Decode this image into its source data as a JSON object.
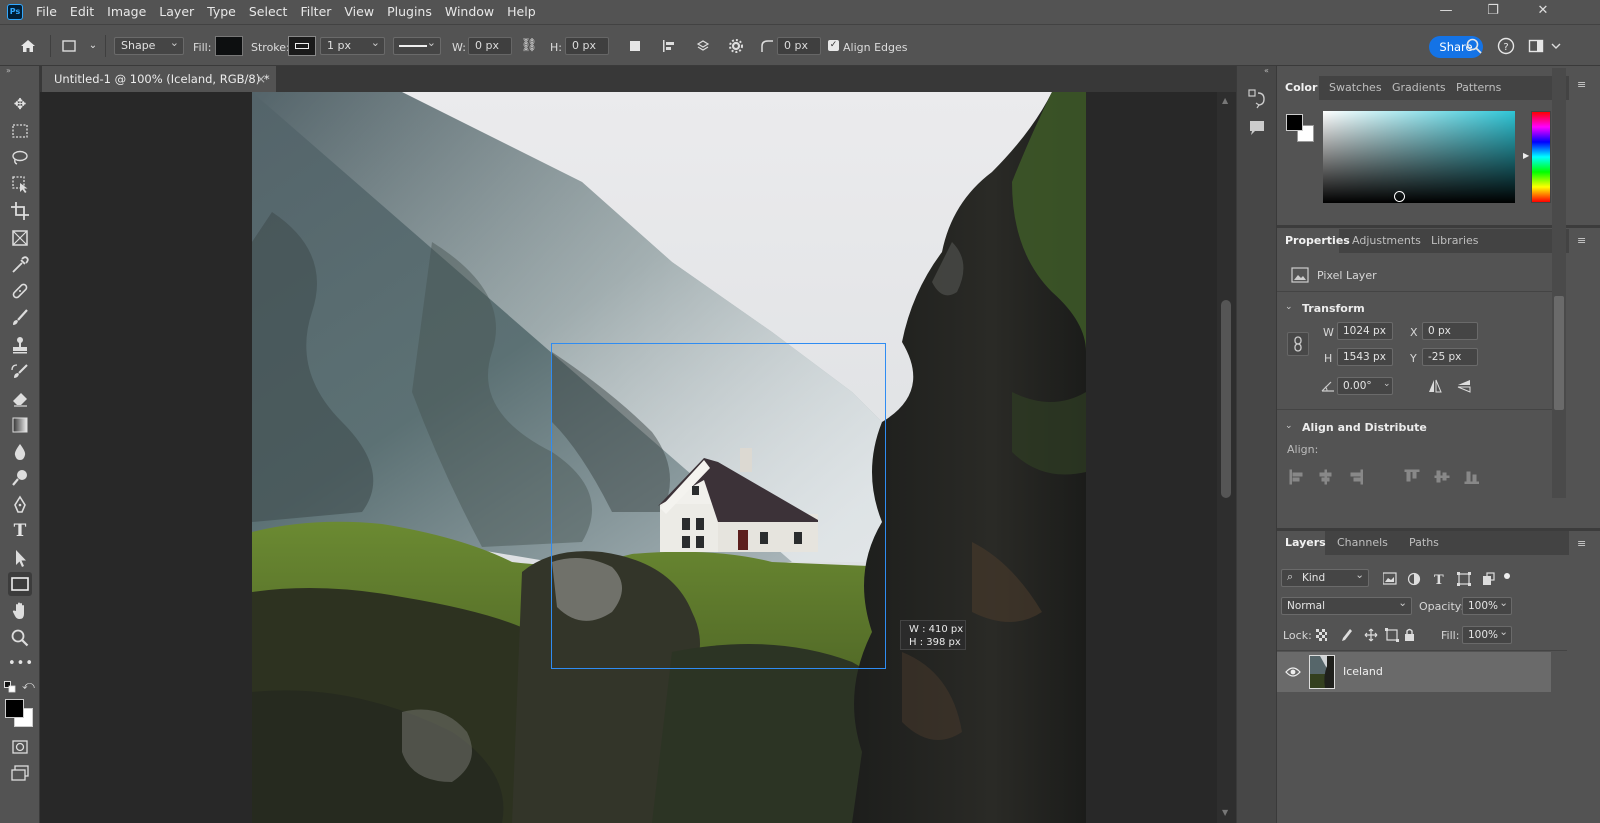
{
  "menubar": {
    "logo": "Ps",
    "items": [
      "File",
      "Edit",
      "Image",
      "Layer",
      "Type",
      "Select",
      "Filter",
      "View",
      "Plugins",
      "Window",
      "Help"
    ],
    "controls": [
      "—",
      "❐",
      "✕"
    ]
  },
  "options": {
    "mode": "Shape",
    "fill_label": "Fill:",
    "fill_color": "#0d0f10",
    "stroke_label": "Stroke:",
    "stroke_width": "1 px",
    "w_label": "W:",
    "w_value": "0 px",
    "h_label": "H:",
    "h_value": "0 px",
    "corner_value": "0 px",
    "align_edges": "Align Edges",
    "share": "Share"
  },
  "document": {
    "tab_title": "Untitled-1 @ 100% (Iceland, RGB/8) *",
    "close": "×"
  },
  "selection_tip": {
    "w": "W :  410 px",
    "h": "H :  398 px"
  },
  "color_panel": {
    "tabs": [
      "Color",
      "Swatches",
      "Gradients",
      "Patterns"
    ],
    "picker_hue": "#2fc5d6",
    "foreground": "#000000",
    "background": "#ffffff"
  },
  "properties_panel": {
    "tabs": [
      "Properties",
      "Adjustments",
      "Libraries"
    ],
    "layer_kind": "Pixel Layer",
    "transform_title": "Transform",
    "w_label": "W",
    "w_value": "1024 px",
    "h_label": "H",
    "h_value": "1543 px",
    "x_label": "X",
    "x_value": "0 px",
    "y_label": "Y",
    "y_value": "-25 px",
    "angle_value": "0.00°",
    "align_title": "Align and Distribute",
    "align_label": "Align:"
  },
  "layers_panel": {
    "tabs": [
      "Layers",
      "Channels",
      "Paths"
    ],
    "kind_label": "Kind",
    "blend_mode": "Normal",
    "opacity_label": "Opacity:",
    "opacity_value": "100%",
    "lock_label": "Lock:",
    "fill_label": "Fill:",
    "fill_value": "100%",
    "layers": [
      {
        "name": "Iceland",
        "visible": true
      }
    ]
  },
  "icons": {
    "home": "home-icon",
    "search": "search-icon",
    "help": "help-icon",
    "workspace": "workspace-icon",
    "gear": "gear-icon"
  },
  "colors": {
    "accent": "#1473e6",
    "selection": "#2f8cf2"
  }
}
